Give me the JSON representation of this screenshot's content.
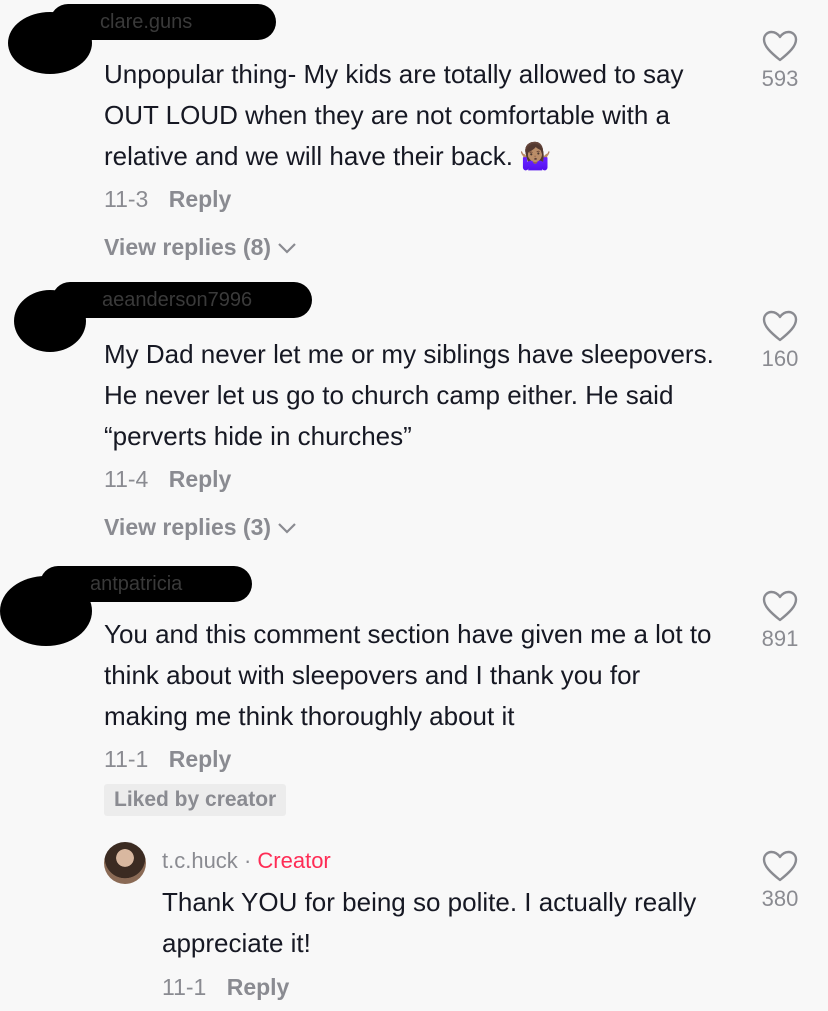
{
  "comments": [
    {
      "username": "clare.guns",
      "text": "Unpopular thing- My kids are totally allowed to say OUT LOUD when they are not comfortable with a relative and we will have their back.",
      "emoji": "🤷🏽‍♀️",
      "date": "11-3",
      "reply_label": "Reply",
      "view_replies": "View replies (8)",
      "likes": "593"
    },
    {
      "username": "aeanderson7996",
      "text": "My Dad never let me or my siblings have sleepovers. He never let us go to church camp either. He said “perverts hide in churches”",
      "date": "11-4",
      "reply_label": "Reply",
      "view_replies": "View replies (3)",
      "likes": "160"
    },
    {
      "username": "antpatricia",
      "text": "You and this comment section have given me a lot to think about with sleepovers and I thank you for making me think thoroughly about it",
      "date": "11-1",
      "reply_label": "Reply",
      "liked_by": "Liked by creator",
      "likes": "891"
    }
  ],
  "creator_reply": {
    "username": "t.c.huck",
    "separator": "·",
    "badge": "Creator",
    "text": "Thank YOU for being so polite. I actually really appreciate it!",
    "date": "11-1",
    "reply_label": "Reply",
    "likes": "380"
  },
  "icons": {
    "like": "heart-outline-icon",
    "expand": "chevron-down-icon"
  },
  "colors": {
    "creator": "#fe2c55",
    "muted": "#8a8b91",
    "text": "#161823"
  }
}
